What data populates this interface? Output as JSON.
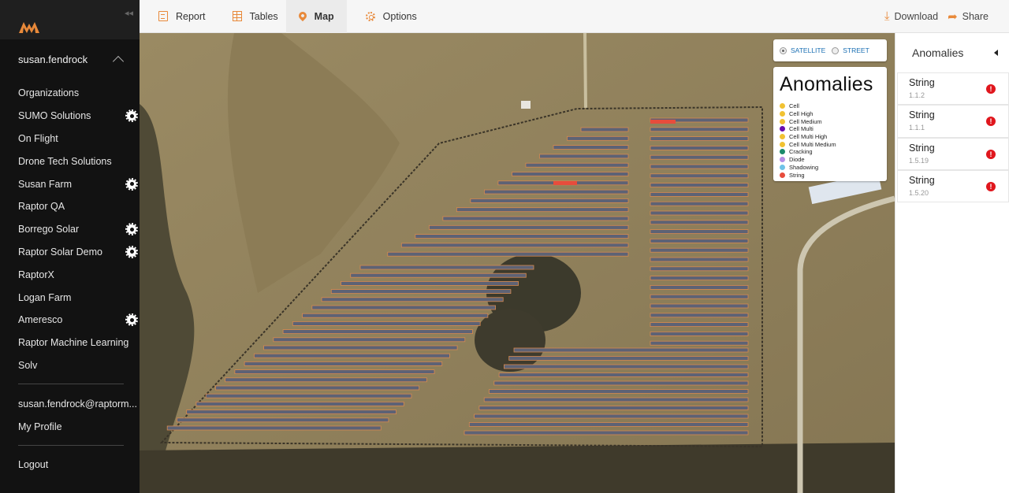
{
  "colors": {
    "accent": "#e8893a",
    "sidebar_bg": "#121212",
    "warn": "#e0161d",
    "string_marker": "#e74c3c"
  },
  "sidebar": {
    "user": "susan.fendrock",
    "orgs": [
      {
        "label": "Organizations",
        "gear": false
      },
      {
        "label": "SUMO Solutions",
        "gear": true
      },
      {
        "label": "On Flight",
        "gear": false
      },
      {
        "label": "Drone Tech Solutions",
        "gear": false
      },
      {
        "label": "Susan Farm",
        "gear": true
      },
      {
        "label": "Raptor QA",
        "gear": false
      },
      {
        "label": "Borrego Solar",
        "gear": true
      },
      {
        "label": "Raptor Solar Demo",
        "gear": true
      },
      {
        "label": "RaptorX",
        "gear": false
      },
      {
        "label": "Logan Farm",
        "gear": false
      },
      {
        "label": "Ameresco",
        "gear": true
      },
      {
        "label": "Raptor Machine Learning",
        "gear": false
      },
      {
        "label": "Solv",
        "gear": false
      }
    ],
    "email": "susan.fendrock@raptorm...",
    "profile": "My Profile",
    "logout": "Logout"
  },
  "topbar": {
    "tabs": [
      {
        "label": "Report",
        "icon": "document-icon"
      },
      {
        "label": "Tables",
        "icon": "table-icon"
      },
      {
        "label": "Map",
        "icon": "map-pin-icon"
      },
      {
        "label": "Options",
        "icon": "gear-icon"
      }
    ],
    "download": "Download",
    "share": "Share"
  },
  "map": {
    "layers": {
      "satellite": "SATELLITE",
      "street": "STREET",
      "selected": "SATELLITE"
    },
    "legend": {
      "title": "Anomalies",
      "items": [
        {
          "label": "Cell",
          "color": "#f1c232"
        },
        {
          "label": "Cell High",
          "color": "#f1c232"
        },
        {
          "label": "Cell Medium",
          "color": "#f1c232"
        },
        {
          "label": "Cell Multi",
          "color": "#6a0dad"
        },
        {
          "label": "Cell Multi High",
          "color": "#f1c232"
        },
        {
          "label": "Cell Multi Medium",
          "color": "#f1c232"
        },
        {
          "label": "Cracking",
          "color": "#1b8a6b"
        },
        {
          "label": "Diode",
          "color": "#b48ee6"
        },
        {
          "label": "Shadowing",
          "color": "#6fc3e8"
        },
        {
          "label": "String",
          "color": "#e74c3c"
        }
      ]
    }
  },
  "panel": {
    "title": "Anomalies",
    "items": [
      {
        "type": "String",
        "id": "1.1.2"
      },
      {
        "type": "String",
        "id": "1.1.1"
      },
      {
        "type": "String",
        "id": "1.5.19"
      },
      {
        "type": "String",
        "id": "1.5.20"
      }
    ]
  }
}
